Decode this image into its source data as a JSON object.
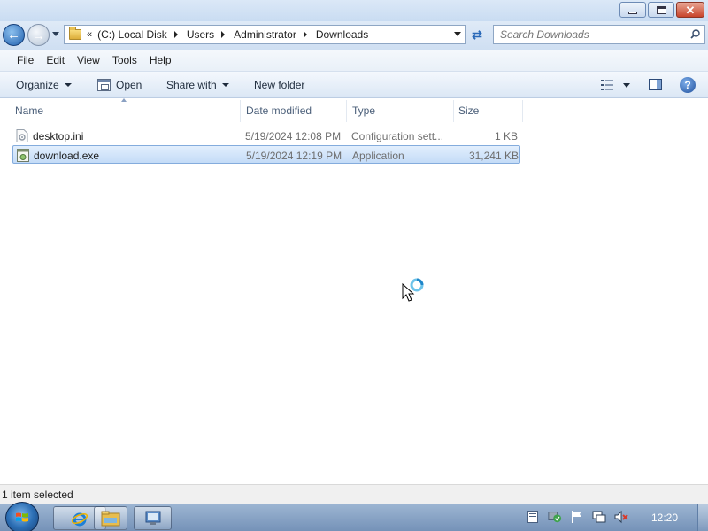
{
  "window": {
    "controls": {
      "minimize": "minimize",
      "maximize": "maximize",
      "close": "✕"
    }
  },
  "nav": {
    "address": {
      "overflow": "«",
      "crumbs": [
        "(C:) Local Disk",
        "Users",
        "Administrator",
        "Downloads"
      ]
    },
    "search": {
      "placeholder": "Search Downloads"
    }
  },
  "menu": [
    "File",
    "Edit",
    "View",
    "Tools",
    "Help"
  ],
  "toolbar": {
    "organize": "Organize",
    "open": "Open",
    "share_with": "Share with",
    "new_folder": "New folder"
  },
  "columns": {
    "name": "Name",
    "date": "Date modified",
    "type": "Type",
    "size": "Size"
  },
  "files": [
    {
      "name": "desktop.ini",
      "date": "5/19/2024 12:08 PM",
      "type": "Configuration sett...",
      "size": "1 KB",
      "icon": "config-file-icon",
      "selected": false
    },
    {
      "name": "download.exe",
      "date": "5/19/2024 12:19 PM",
      "type": "Application",
      "size": "31,241 KB",
      "icon": "application-icon",
      "selected": true
    }
  ],
  "status": {
    "text": "1 item selected"
  },
  "taskbar": {
    "clock": "12:20",
    "pinned": [
      "internet-explorer-icon",
      "windows-explorer-icon",
      "network-connections-icon"
    ]
  },
  "colors": {
    "selection": "#c4dcf7",
    "selection_border": "#84acdd",
    "taskbar": "#7592b8"
  }
}
